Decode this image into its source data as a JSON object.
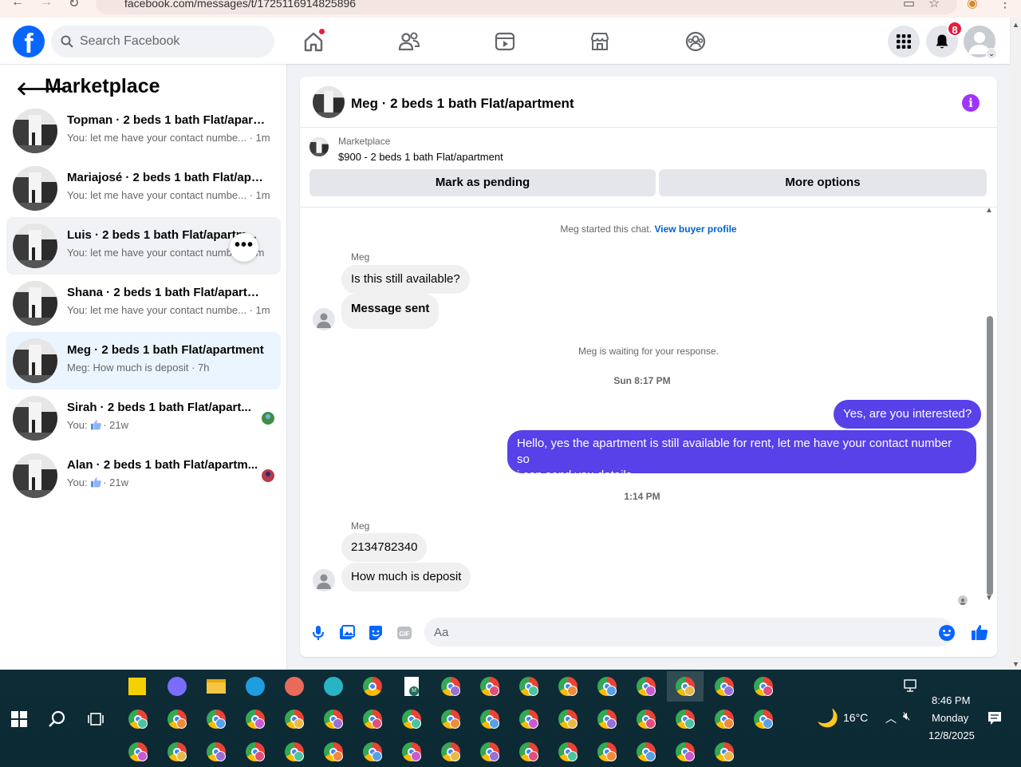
{
  "browser": {
    "url": "facebook.com/messages/t/1725116914825896"
  },
  "topbar": {
    "logo": "f",
    "search_placeholder": "Search Facebook",
    "notifications_count": "8",
    "nav": [
      "home-icon",
      "friends-icon",
      "video-icon",
      "marketplace-icon",
      "groups-icon"
    ],
    "accent": "#0866ff"
  },
  "left": {
    "title": "Marketplace",
    "conversations": [
      {
        "title": "Topman · 2 beds 1 bath Flat/apart...",
        "preview": "You: let me have your contact numbe... · 1m"
      },
      {
        "title": "Mariajosé · 2 beds 1 bath Flat/apar...",
        "preview": "You: let me have your contact numbe... · 1m"
      },
      {
        "title": "Luis · 2 beds 1 bath Flat/apartm...",
        "preview": "You: let me have your contact numb... · 1m"
      },
      {
        "title": "Shana · 2 beds 1 bath Flat/apartme...",
        "preview": "You: let me have your contact numbe... · 1m"
      },
      {
        "title": "Meg · 2 beds 1 bath Flat/apartment",
        "preview": "Meg: How much is deposit · 7h"
      },
      {
        "title": "Sirah · 2 beds 1 bath Flat/apart...",
        "preview_prefix": "You:",
        "preview_suffix": "· 21w"
      },
      {
        "title": "Alan · 2 beds 1 bath Flat/apartm...",
        "preview_prefix": "You:",
        "preview_suffix": "· 21w"
      }
    ],
    "more_label": "•••"
  },
  "chat": {
    "title": "Meg · 2 beds 1 bath Flat/apartment",
    "info_label": "i",
    "listing_source": "Marketplace",
    "listing_desc": "$900 - 2 beds 1 bath Flat/apartment",
    "btn_pending": "Mark as pending",
    "btn_more": "More options",
    "started": "Meg started this chat.",
    "view_profile": "View buyer profile",
    "sender_name": "Meg",
    "msg1": "Is this still available?",
    "msg2": "Message sent",
    "waiting": "Meg is waiting for your response.",
    "ts1": "Sun 8:17 PM",
    "out1": "Yes, are you interested?",
    "out2_line1": "Hello, yes the apartment is still available for rent, let me have your contact number so",
    "out2_line2": "i can send you details",
    "ts2": "1:14 PM",
    "msg3": "2134782340",
    "msg4": "How much is deposit",
    "composer_placeholder": "Aa",
    "outgoing_color": "#5741e8"
  },
  "taskbar": {
    "temp": "16°C",
    "time": "8:46 PM",
    "day": "Monday",
    "date": "12/8/2025"
  }
}
